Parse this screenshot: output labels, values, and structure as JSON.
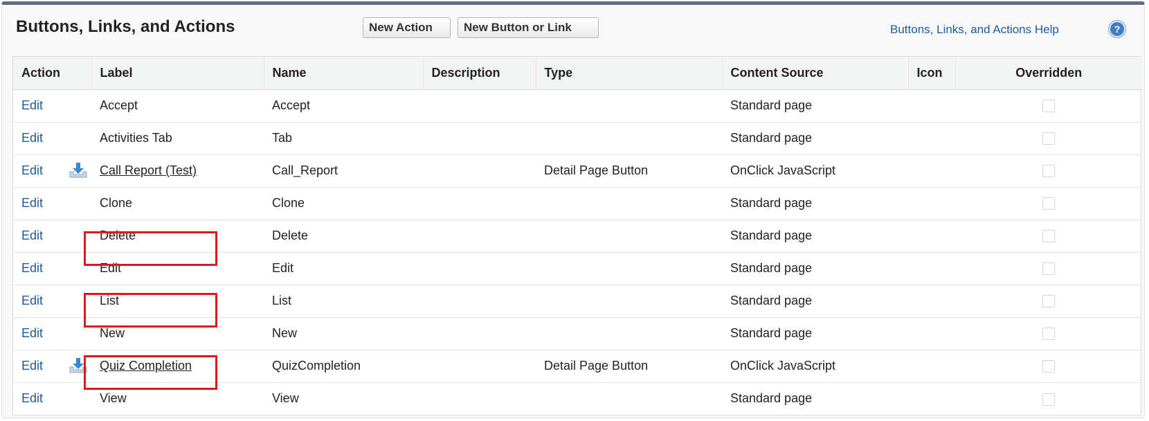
{
  "header": {
    "title": "Buttons, Links, and Actions",
    "new_action_label": "New Action",
    "new_button_label": "New Button or Link",
    "help_label": "Buttons, Links, and Actions Help",
    "help_icon_glyph": "?"
  },
  "table": {
    "columns": [
      "Action",
      "Label",
      "Name",
      "Description",
      "Type",
      "Content Source",
      "Icon",
      "Overridden"
    ],
    "rows": [
      {
        "action": "Edit",
        "label": "Accept",
        "name": "Accept",
        "description": "",
        "type": "",
        "content_source": "Standard page",
        "icon": "",
        "overridden": false,
        "custom": false
      },
      {
        "action": "Edit",
        "label": "Activities Tab",
        "name": "Tab",
        "description": "",
        "type": "",
        "content_source": "Standard page",
        "icon": "",
        "overridden": false,
        "custom": false
      },
      {
        "action": "Edit",
        "label": "Call Report (Test)",
        "name": "Call_Report",
        "description": "",
        "type": "Detail Page Button",
        "content_source": "OnClick JavaScript",
        "icon": "",
        "overridden": false,
        "custom": true
      },
      {
        "action": "Edit",
        "label": "Clone",
        "name": "Clone",
        "description": "",
        "type": "",
        "content_source": "Standard page",
        "icon": "",
        "overridden": false,
        "custom": false
      },
      {
        "action": "Edit",
        "label": "Delete",
        "name": "Delete",
        "description": "",
        "type": "",
        "content_source": "Standard page",
        "icon": "",
        "overridden": false,
        "custom": false
      },
      {
        "action": "Edit",
        "label": "Edit",
        "name": "Edit",
        "description": "",
        "type": "",
        "content_source": "Standard page",
        "icon": "",
        "overridden": false,
        "custom": false
      },
      {
        "action": "Edit",
        "label": "List",
        "name": "List",
        "description": "",
        "type": "",
        "content_source": "Standard page",
        "icon": "",
        "overridden": false,
        "custom": false
      },
      {
        "action": "Edit",
        "label": "New",
        "name": "New",
        "description": "",
        "type": "",
        "content_source": "Standard page",
        "icon": "",
        "overridden": false,
        "custom": false
      },
      {
        "action": "Edit",
        "label": "Quiz Completion",
        "name": "QuizCompletion",
        "description": "",
        "type": "Detail Page Button",
        "content_source": "OnClick JavaScript",
        "icon": "",
        "overridden": false,
        "custom": true
      },
      {
        "action": "Edit",
        "label": "View",
        "name": "View",
        "description": "",
        "type": "",
        "content_source": "Standard page",
        "icon": "",
        "overridden": false,
        "custom": false
      }
    ]
  },
  "icons": {
    "custom_button": "download-arrow-icon",
    "help": "help-icon"
  },
  "colors": {
    "header_bar": "#5d6b84",
    "link": "#1d5a9c",
    "highlight": "#e4161f"
  }
}
